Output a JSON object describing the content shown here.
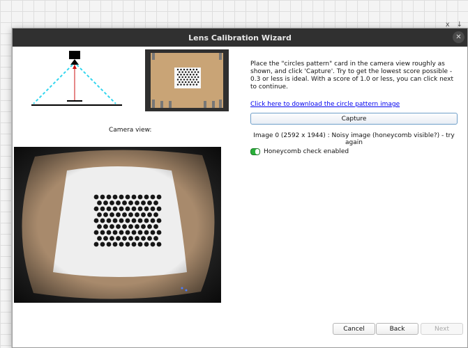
{
  "background": {
    "controls": [
      "x",
      "↓"
    ]
  },
  "dialog": {
    "title": "Lens Calibration Wizard",
    "close_glyph": "✕",
    "camera_label": "Camera view:",
    "instructions": "Place the \"circles pattern\" card in the camera view roughly as shown, and click 'Capture'. Try to get the lowest score possible - 0.3 or less is ideal. With a score of 1.0 or less, you can click next to continue.",
    "download_link": "Click here to download the circle pattern image",
    "capture_label": "Capture",
    "status": "Image 0 (2592 x 1944) : Noisy image (honeycomb visible?) - try again",
    "honeycomb_label": "Honeycomb check enabled",
    "honeycomb_enabled": true,
    "buttons": {
      "cancel": "Cancel",
      "back": "Back",
      "next": "Next"
    },
    "next_enabled": false
  }
}
